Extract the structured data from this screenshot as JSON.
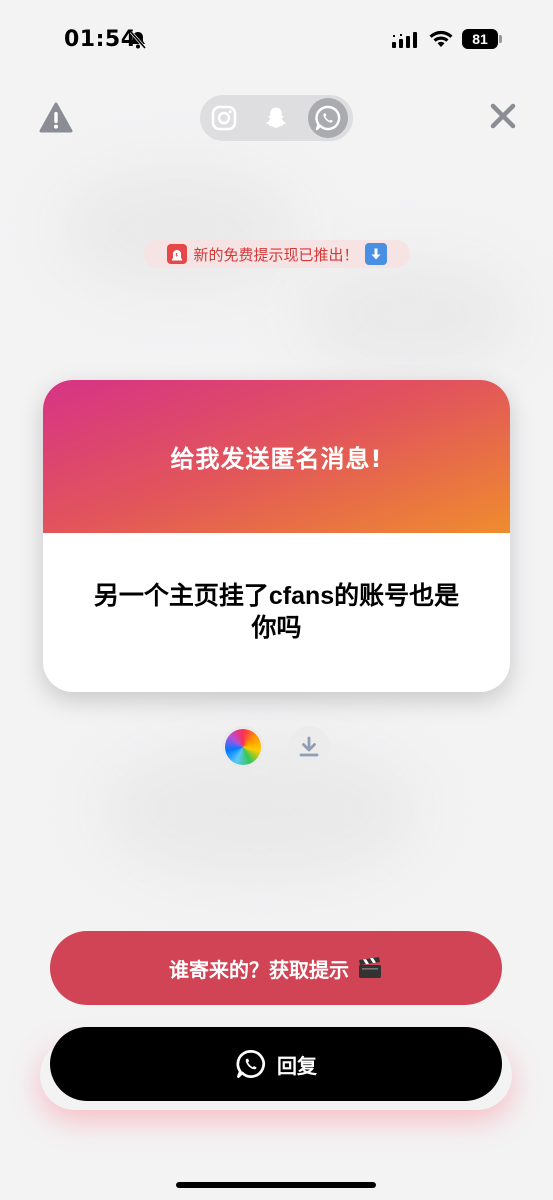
{
  "status_bar": {
    "time": "01:54",
    "battery": "81"
  },
  "top_bar": {
    "platforms": [
      {
        "icon": "instagram-icon",
        "active": false
      },
      {
        "icon": "snapchat-icon",
        "active": false
      },
      {
        "icon": "whatsapp-icon",
        "active": true
      }
    ]
  },
  "banner": {
    "text": "新的免费提示现已推出！"
  },
  "card": {
    "title": "给我发送匿名消息!",
    "message": "另一个主页挂了cfans的账号也是你吗",
    "gradient_colors": [
      "#d63386",
      "#e2565a",
      "#ef8c2e"
    ]
  },
  "actions": {
    "hint_label": "谁寄来的？获取提示",
    "reply_label": "回复"
  },
  "colors": {
    "hint_button": "#d04455",
    "reply_button": "#000000",
    "banner_text": "#d23a3a"
  }
}
